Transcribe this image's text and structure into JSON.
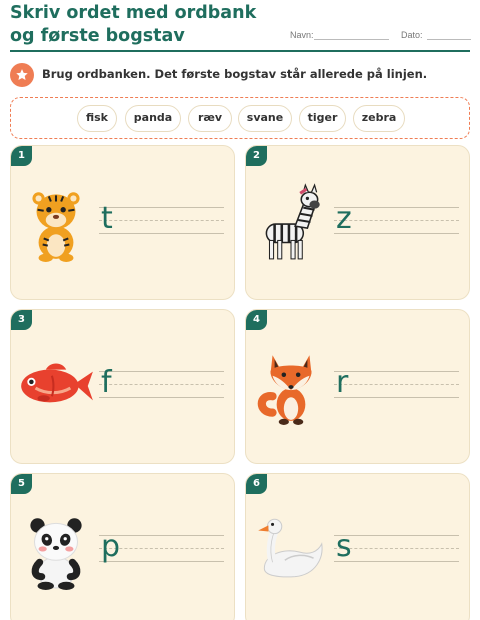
{
  "header": {
    "title": "Skriv ordet med ordbank og første bogstav",
    "name_label": "Navn:",
    "date_label": "Dato:"
  },
  "instruction": {
    "icon": "star-icon",
    "text": "Brug ordbanken. Det første bogstav står allerede på linjen."
  },
  "word_bank": [
    "fisk",
    "panda",
    "ræv",
    "svane",
    "tiger",
    "zebra"
  ],
  "cards": [
    {
      "number": "1",
      "letter": "t",
      "picture": "tiger"
    },
    {
      "number": "2",
      "letter": "z",
      "picture": "zebra"
    },
    {
      "number": "3",
      "letter": "f",
      "picture": "fish"
    },
    {
      "number": "4",
      "letter": "r",
      "picture": "fox"
    },
    {
      "number": "5",
      "letter": "p",
      "picture": "panda"
    },
    {
      "number": "6",
      "letter": "s",
      "picture": "swan"
    }
  ],
  "colors": {
    "accent": "#1f6e5e",
    "orange": "#ef7d54",
    "card_bg": "#fcf3e0"
  }
}
